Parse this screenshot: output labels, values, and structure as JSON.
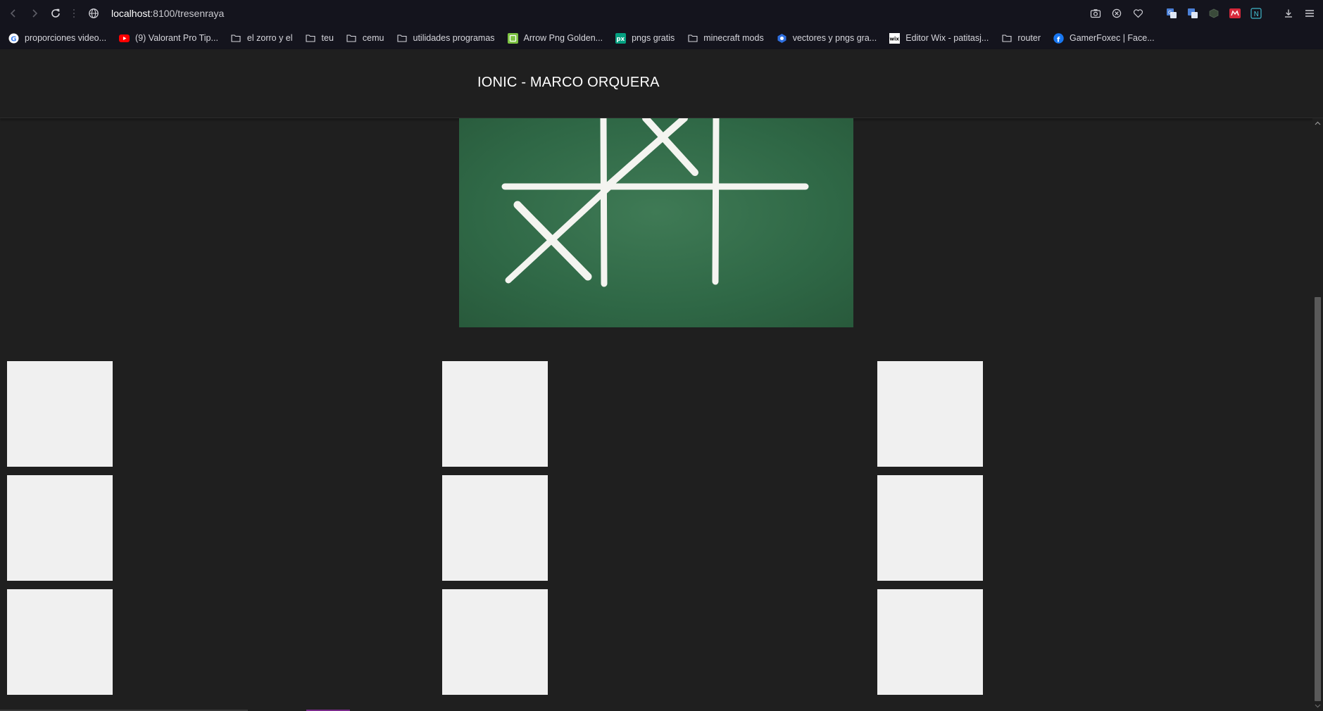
{
  "browser": {
    "url_host": "localhost",
    "url_rest": ":8100/tresenraya",
    "bookmarks": [
      {
        "label": "proporciones video...",
        "icon": "google-icon"
      },
      {
        "label": "(9) Valorant Pro Tip...",
        "icon": "youtube-icon"
      },
      {
        "label": "el zorro y el",
        "icon": "folder-icon"
      },
      {
        "label": "teu",
        "icon": "folder-icon"
      },
      {
        "label": "cemu",
        "icon": "folder-icon"
      },
      {
        "label": "utilidades programas",
        "icon": "folder-icon"
      },
      {
        "label": "Arrow Png Golden...",
        "icon": "pngtree-icon"
      },
      {
        "label": "pngs gratis",
        "icon": "px-icon"
      },
      {
        "label": "minecraft mods",
        "icon": "folder-icon"
      },
      {
        "label": "vectores y pngs gra...",
        "icon": "vector-site-icon"
      },
      {
        "label": "Editor Wix - patitasj...",
        "icon": "wix-icon"
      },
      {
        "label": "router",
        "icon": "folder-icon"
      },
      {
        "label": "GamerFoxec | Face...",
        "icon": "facebook-icon"
      }
    ]
  },
  "app": {
    "title": "IONIC - MARCO ORQUERA",
    "board_cells": [
      "",
      "",
      "",
      "",
      "",
      "",
      "",
      "",
      ""
    ]
  }
}
